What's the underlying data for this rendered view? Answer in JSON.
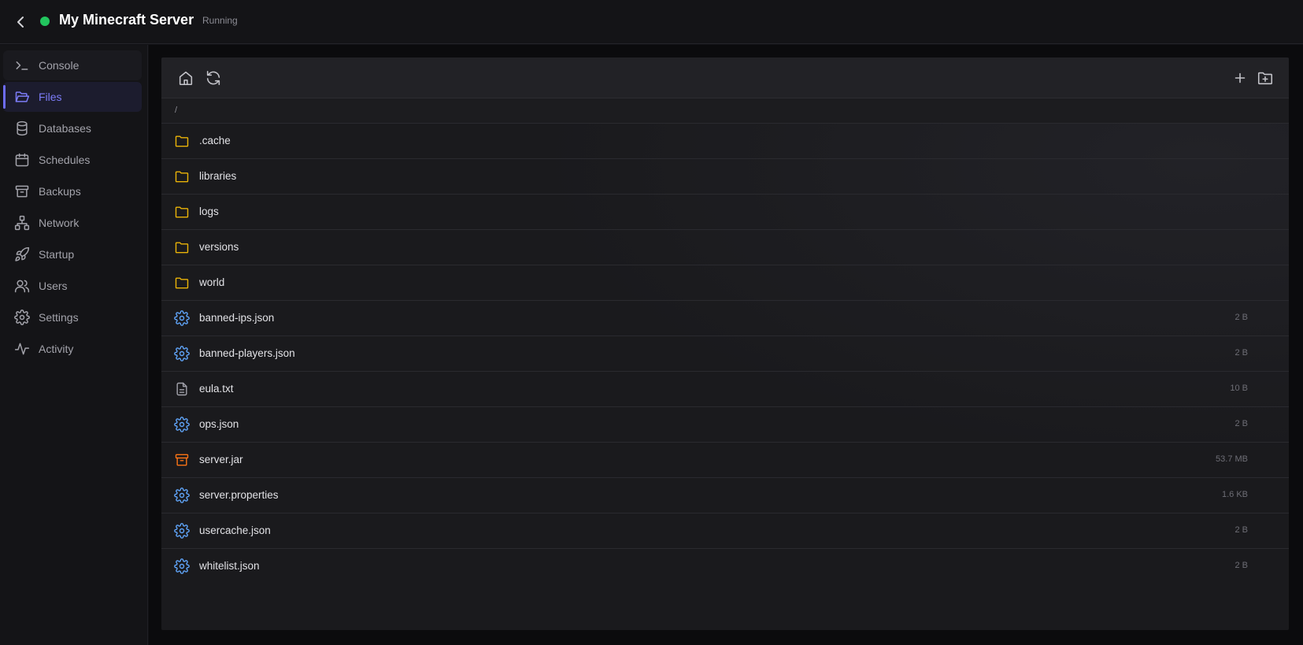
{
  "header": {
    "back_icon": "chevron-left-icon",
    "server_name": "My Minecraft Server",
    "status": "Running",
    "status_color": "#22c55e"
  },
  "sidebar": {
    "accent_color": "#6d6cf7",
    "items": [
      {
        "label": "Console",
        "icon": "terminal-icon"
      },
      {
        "label": "Files",
        "icon": "folder-open-icon",
        "active": true
      },
      {
        "label": "Databases",
        "icon": "database-icon"
      },
      {
        "label": "Schedules",
        "icon": "calendar-icon"
      },
      {
        "label": "Backups",
        "icon": "archive-icon"
      },
      {
        "label": "Network",
        "icon": "network-icon"
      },
      {
        "label": "Startup",
        "icon": "rocket-icon"
      },
      {
        "label": "Users",
        "icon": "users-icon"
      },
      {
        "label": "Settings",
        "icon": "gear-icon"
      },
      {
        "label": "Activity",
        "icon": "activity-icon"
      }
    ]
  },
  "toolbar": {
    "left": [
      "home-icon",
      "refresh-icon"
    ],
    "right": [
      "plus-icon",
      "new-folder-icon"
    ]
  },
  "path": "/",
  "files": [
    {
      "name": ".cache",
      "type": "folder",
      "size": ""
    },
    {
      "name": "libraries",
      "type": "folder",
      "size": ""
    },
    {
      "name": "logs",
      "type": "folder",
      "size": ""
    },
    {
      "name": "versions",
      "type": "folder",
      "size": ""
    },
    {
      "name": "world",
      "type": "folder",
      "size": ""
    },
    {
      "name": "banned-ips.json",
      "type": "config",
      "size": "2 B"
    },
    {
      "name": "banned-players.json",
      "type": "config",
      "size": "2 B"
    },
    {
      "name": "eula.txt",
      "type": "text",
      "size": "10 B"
    },
    {
      "name": "ops.json",
      "type": "config",
      "size": "2 B"
    },
    {
      "name": "server.jar",
      "type": "archive",
      "size": "53.7 MB"
    },
    {
      "name": "server.properties",
      "type": "config",
      "size": "1.6 KB"
    },
    {
      "name": "usercache.json",
      "type": "config",
      "size": "2 B"
    },
    {
      "name": "whitelist.json",
      "type": "config",
      "size": "2 B"
    }
  ],
  "colors": {
    "folder": "#eab308",
    "config": "#60a5fa",
    "text": "#a1a1aa",
    "archive": "#f97316"
  }
}
